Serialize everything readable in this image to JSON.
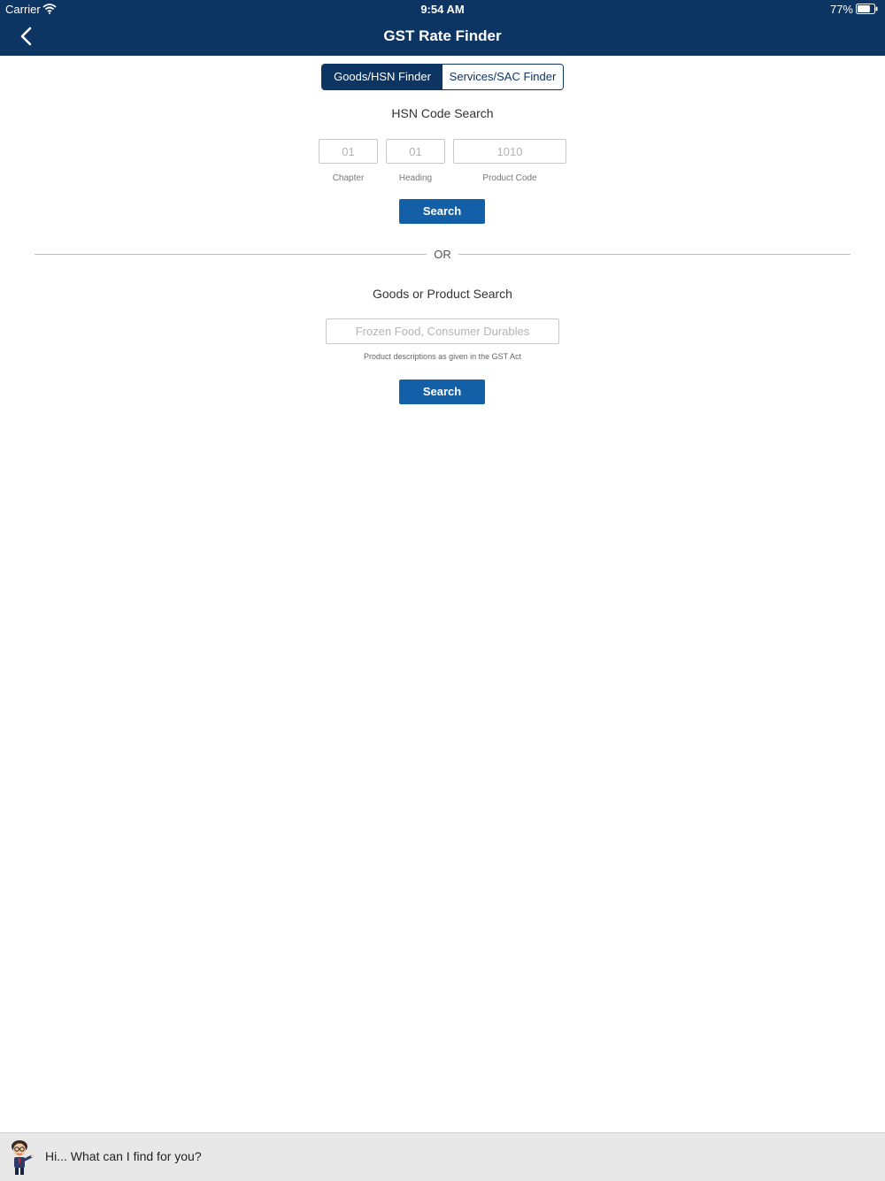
{
  "status_bar": {
    "carrier": "Carrier",
    "time": "9:54 AM",
    "battery": "77%",
    "battery_level": 0.77,
    "icons": [
      "wifi-icon",
      "battery-icon"
    ]
  },
  "nav": {
    "title": "GST Rate Finder",
    "back_icon": "chevron-left-icon"
  },
  "tabs": [
    {
      "label": "Goods/HSN Finder",
      "selected": true
    },
    {
      "label": "Services/SAC Finder",
      "selected": false
    }
  ],
  "hsn_search": {
    "title": "HSN Code Search",
    "fields": [
      {
        "placeholder": "01",
        "caption": "Chapter"
      },
      {
        "placeholder": "01",
        "caption": "Heading"
      },
      {
        "placeholder": "1010",
        "caption": "Product Code"
      }
    ],
    "search_label": "Search"
  },
  "divider_label": "OR",
  "product_search": {
    "title": "Goods or Product Search",
    "placeholder": "Frozen Food, Consumer Durables",
    "helper": "Product descriptions as given in the GST Act",
    "search_label": "Search"
  },
  "chat": {
    "prompt": "Hi... What can I find for you?",
    "avatar_icon": "assistant-avatar-icon"
  },
  "colors": {
    "brand_navy": "#0d3564",
    "button_blue": "#1360a8",
    "chat_bar_bg": "#e8e8e8"
  }
}
